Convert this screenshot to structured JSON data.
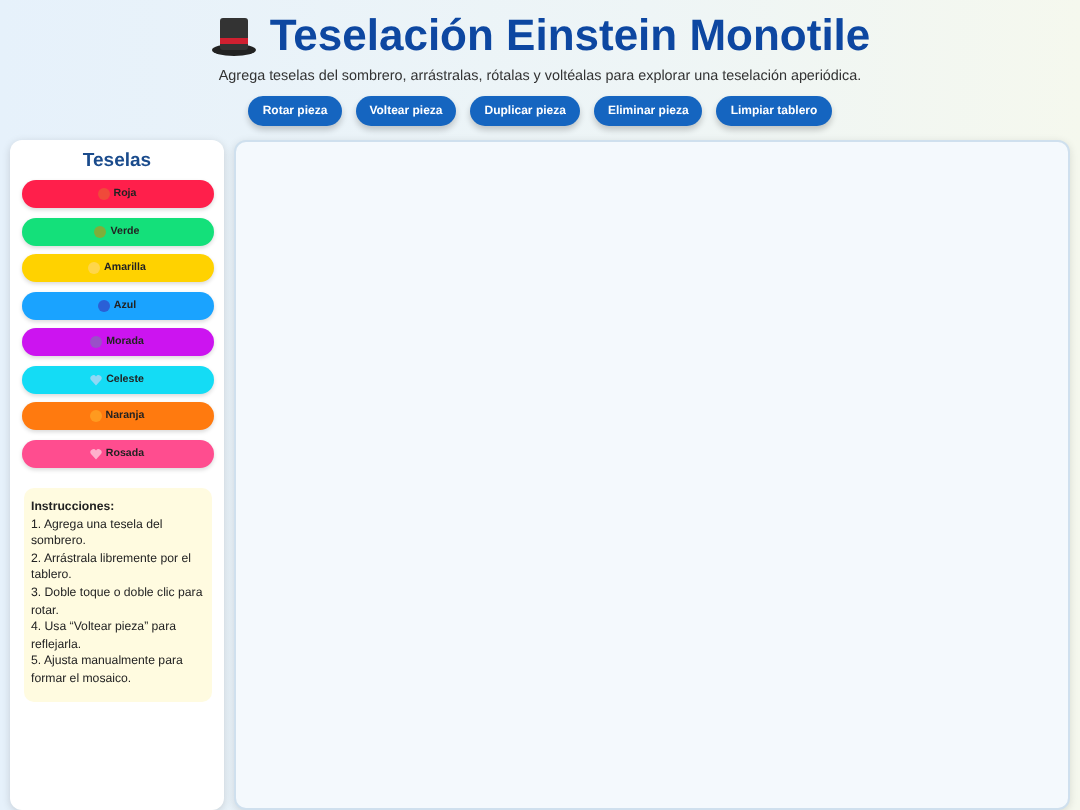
{
  "header": {
    "title": "Teselación Einstein Monotile",
    "subtitle": "Agrega teselas del sombrero, arrástralas, rótalas y voltéalas para explorar una teselación aperiódica."
  },
  "toolbar": [
    "Rotar pieza",
    "Voltear pieza",
    "Duplicar pieza",
    "Eliminar pieza",
    "Limpiar tablero"
  ],
  "sidebar": {
    "title": "Teselas",
    "tiles": [
      {
        "label": "Roja",
        "color": "#ff1f4b",
        "icon": {
          "kind": "circle",
          "color": "#f04a3a"
        }
      },
      {
        "label": "Verde",
        "color": "#14e07a",
        "icon": {
          "kind": "circle",
          "color": "#7fae3a"
        }
      },
      {
        "label": "Amarilla",
        "color": "#ffd200",
        "icon": {
          "kind": "circle",
          "color": "#ffd64a"
        }
      },
      {
        "label": "Azul",
        "color": "#1aa3ff",
        "icon": {
          "kind": "circle",
          "color": "#2a5fd6"
        }
      },
      {
        "label": "Morada",
        "color": "#cc14f0",
        "icon": {
          "kind": "circle",
          "color": "#9a50c8"
        }
      },
      {
        "label": "Celeste",
        "color": "#14dcf5",
        "icon": {
          "kind": "heart",
          "color": "#8fd8f5"
        }
      },
      {
        "label": "Naranja",
        "color": "#ff7a0f",
        "icon": {
          "kind": "circle",
          "color": "#ff9a1f"
        }
      },
      {
        "label": "Rosada",
        "color": "#ff4d8f",
        "icon": {
          "kind": "heart",
          "color": "#ffb0cc"
        }
      }
    ],
    "instructions": {
      "heading": "Instrucciones:",
      "lines": [
        "1. Agrega una tesela del sombrero.",
        "2. Arrástrala libremente por el tablero.",
        "3. Doble toque o doble clic para rotar.",
        "4. Usa “Voltear pieza” para reflejarla.",
        "5. Ajusta manualmente para formar el mosaico."
      ]
    }
  }
}
